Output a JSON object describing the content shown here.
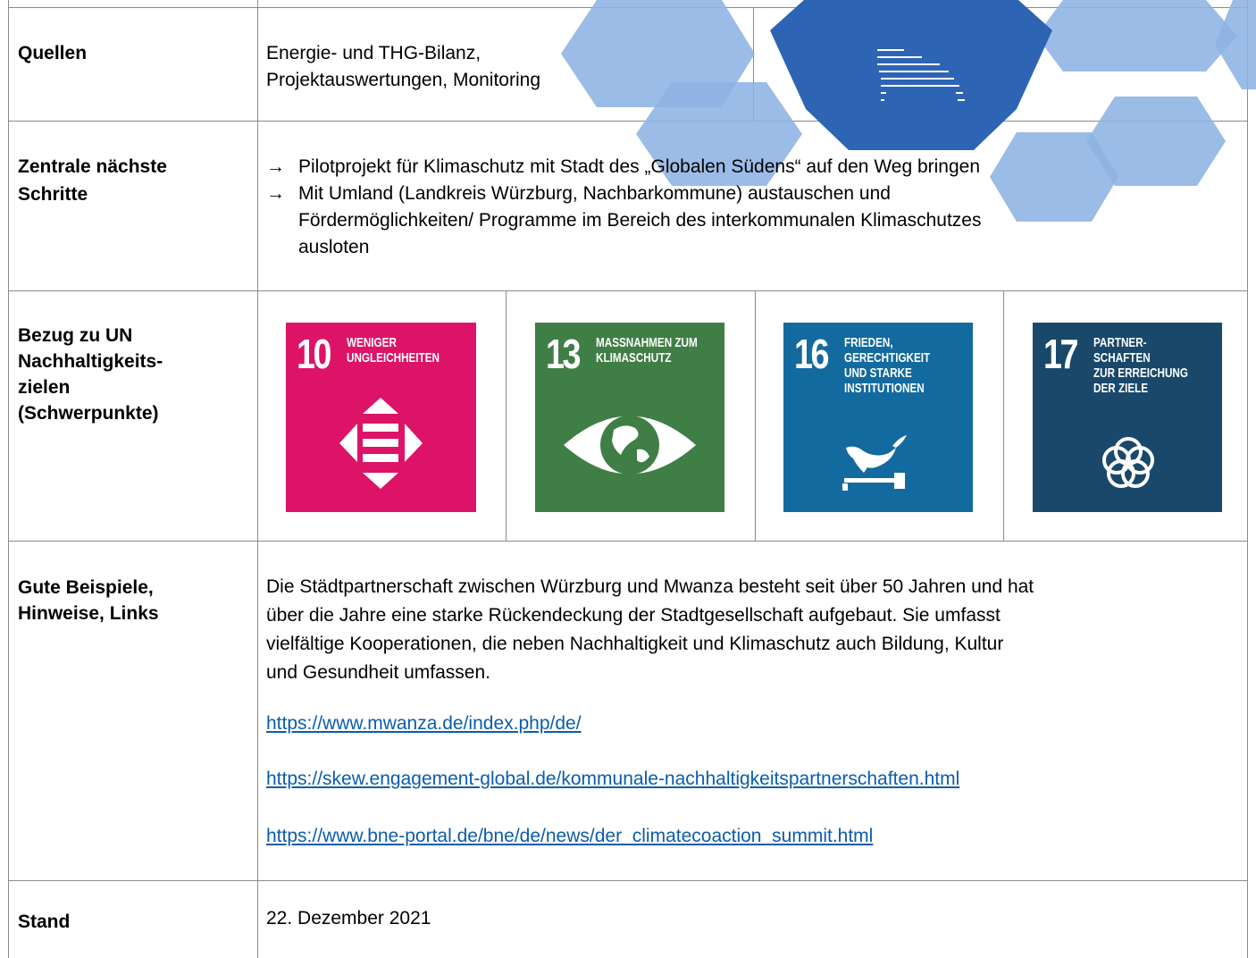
{
  "rows": {
    "quellen": {
      "label": "Quellen",
      "line1": "Energie- und THG-Bilanz,",
      "line2": "Projektauswertungen, Monitoring"
    },
    "schritte": {
      "label_line1": "Zentrale nächste",
      "label_line2": "Schritte",
      "arrow": "→",
      "item1": "Pilotprojekt für Klimaschutz mit Stadt des „Globalen Südens“ auf den Weg bringen",
      "item2_line1": "Mit Umland (Landkreis Würzburg, Nachbarkommune) austauschen und",
      "item2_line2": "Fördermöglichkeiten/ Programme im Bereich des interkommunalen Klimaschutzes",
      "item2_line3": "ausloten"
    },
    "sdg": {
      "label_line1": "Bezug zu UN",
      "label_line2": "Nachhaltigkeits-",
      "label_line3": "zielen",
      "label_line4": "(Schwerpunkte)",
      "goals": [
        {
          "number": "10",
          "title": "WENIGER\nUNGLEICHHEITEN",
          "color": "#dd1367",
          "icon": "reduced-inequalities-icon"
        },
        {
          "number": "13",
          "title": "MASSNAHMEN ZUM\nKLIMASCHUTZ",
          "color": "#3f7e44",
          "icon": "eye-globe-icon"
        },
        {
          "number": "16",
          "title": "FRIEDEN,\nGERECHTIGKEIT\nUND STARKE\nINSTITUTIONEN",
          "color": "#136a9f",
          "icon": "dove-gavel-icon"
        },
        {
          "number": "17",
          "title": "PARTNER-\nSCHAFTEN\nZUR ERREICHUNG\nDER ZIELE",
          "color": "#19486a",
          "icon": "rings-icon"
        }
      ]
    },
    "beispiele": {
      "label_line1": "Gute Beispiele,",
      "label_line2": "Hinweise, Links",
      "para_line1": "Die Städtpartnerschaft zwischen Würzburg und Mwanza besteht seit über 50 Jahren und hat",
      "para_line2": "über die Jahre eine starke Rückendeckung der Stadtgesellschaft aufgebaut. Sie umfasst",
      "para_line3": "vielfältige Kooperationen, die neben Nachhaltigkeit und Klimaschutz auch Bildung, Kultur",
      "para_line4": "und Gesundheit umfassen.",
      "link1": "https://www.mwanza.de/index.php/de/",
      "link2": "https://skew.engagement-global.de/kommunale-nachhaltigkeitspartnerschaften.html",
      "link3": "https://www.bne-portal.de/bne/de/news/der_climatecoaction_summit.html"
    },
    "stand": {
      "label": "Stand",
      "value": "22. Dezember 2021"
    }
  },
  "colors": {
    "hex_light": "#8db3e2",
    "hex_dark": "#2e64b4",
    "link": "#0b5cad",
    "border": "#8a8a8a"
  }
}
